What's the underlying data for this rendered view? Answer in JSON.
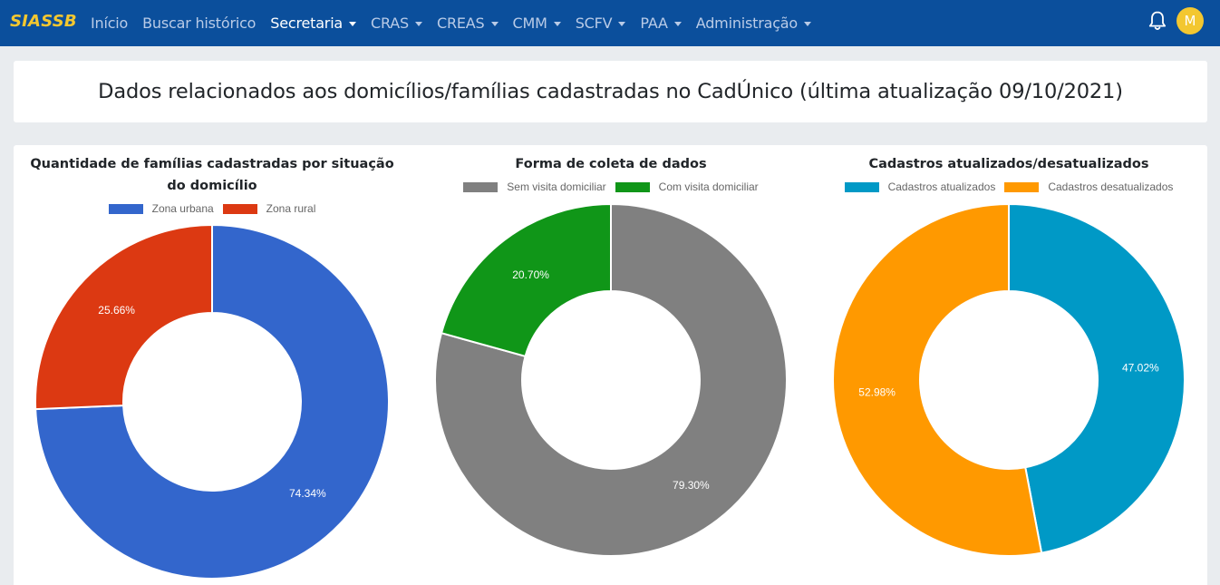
{
  "navbar": {
    "brand": "SIASSB",
    "items": [
      {
        "label": "Início",
        "dropdown": false,
        "active": false
      },
      {
        "label": "Buscar histórico",
        "dropdown": false,
        "active": false
      },
      {
        "label": "Secretaria",
        "dropdown": true,
        "active": true
      },
      {
        "label": "CRAS",
        "dropdown": true,
        "active": false
      },
      {
        "label": "CREAS",
        "dropdown": true,
        "active": false
      },
      {
        "label": "CMM",
        "dropdown": true,
        "active": false
      },
      {
        "label": "SCFV",
        "dropdown": true,
        "active": false
      },
      {
        "label": "PAA",
        "dropdown": true,
        "active": false
      },
      {
        "label": "Administração",
        "dropdown": true,
        "active": false
      }
    ],
    "notification_icon": "bell-icon",
    "avatar_initial": "M",
    "colors": {
      "background": "#0b4f9c",
      "brand": "#f3c730",
      "avatar": "#f3c730"
    }
  },
  "page_title": "Dados relacionados aos domicílios/famílias cadastradas no CadÚnico (última atualização 09/10/2021)",
  "chart_data": [
    {
      "type": "pie",
      "variant": "doughnut",
      "title": "Quantidade de famílias cadastradas por situação do domicílio",
      "categories": [
        "Zona urbana",
        "Zona rural"
      ],
      "values": [
        74.34,
        25.66
      ],
      "labels": [
        "74.34%",
        "25.66%"
      ],
      "colors": [
        "#3366cc",
        "#dc3912"
      ],
      "legend": "top"
    },
    {
      "type": "pie",
      "variant": "doughnut",
      "title": "Forma de coleta de dados",
      "categories": [
        "Sem visita domiciliar",
        "Com visita domiciliar"
      ],
      "values": [
        79.3,
        20.7
      ],
      "labels": [
        "79.30%",
        "20.70%"
      ],
      "colors": [
        "#808080",
        "#109618"
      ],
      "legend": "top"
    },
    {
      "type": "pie",
      "variant": "doughnut",
      "title": "Cadastros atualizados/desatualizados",
      "categories": [
        "Cadastros atualizados",
        "Cadastros desatualizados"
      ],
      "values": [
        47.02,
        52.98
      ],
      "labels": [
        "47.02%",
        "52.98%"
      ],
      "colors": [
        "#0099c6",
        "#ff9900"
      ],
      "legend": "top"
    }
  ]
}
